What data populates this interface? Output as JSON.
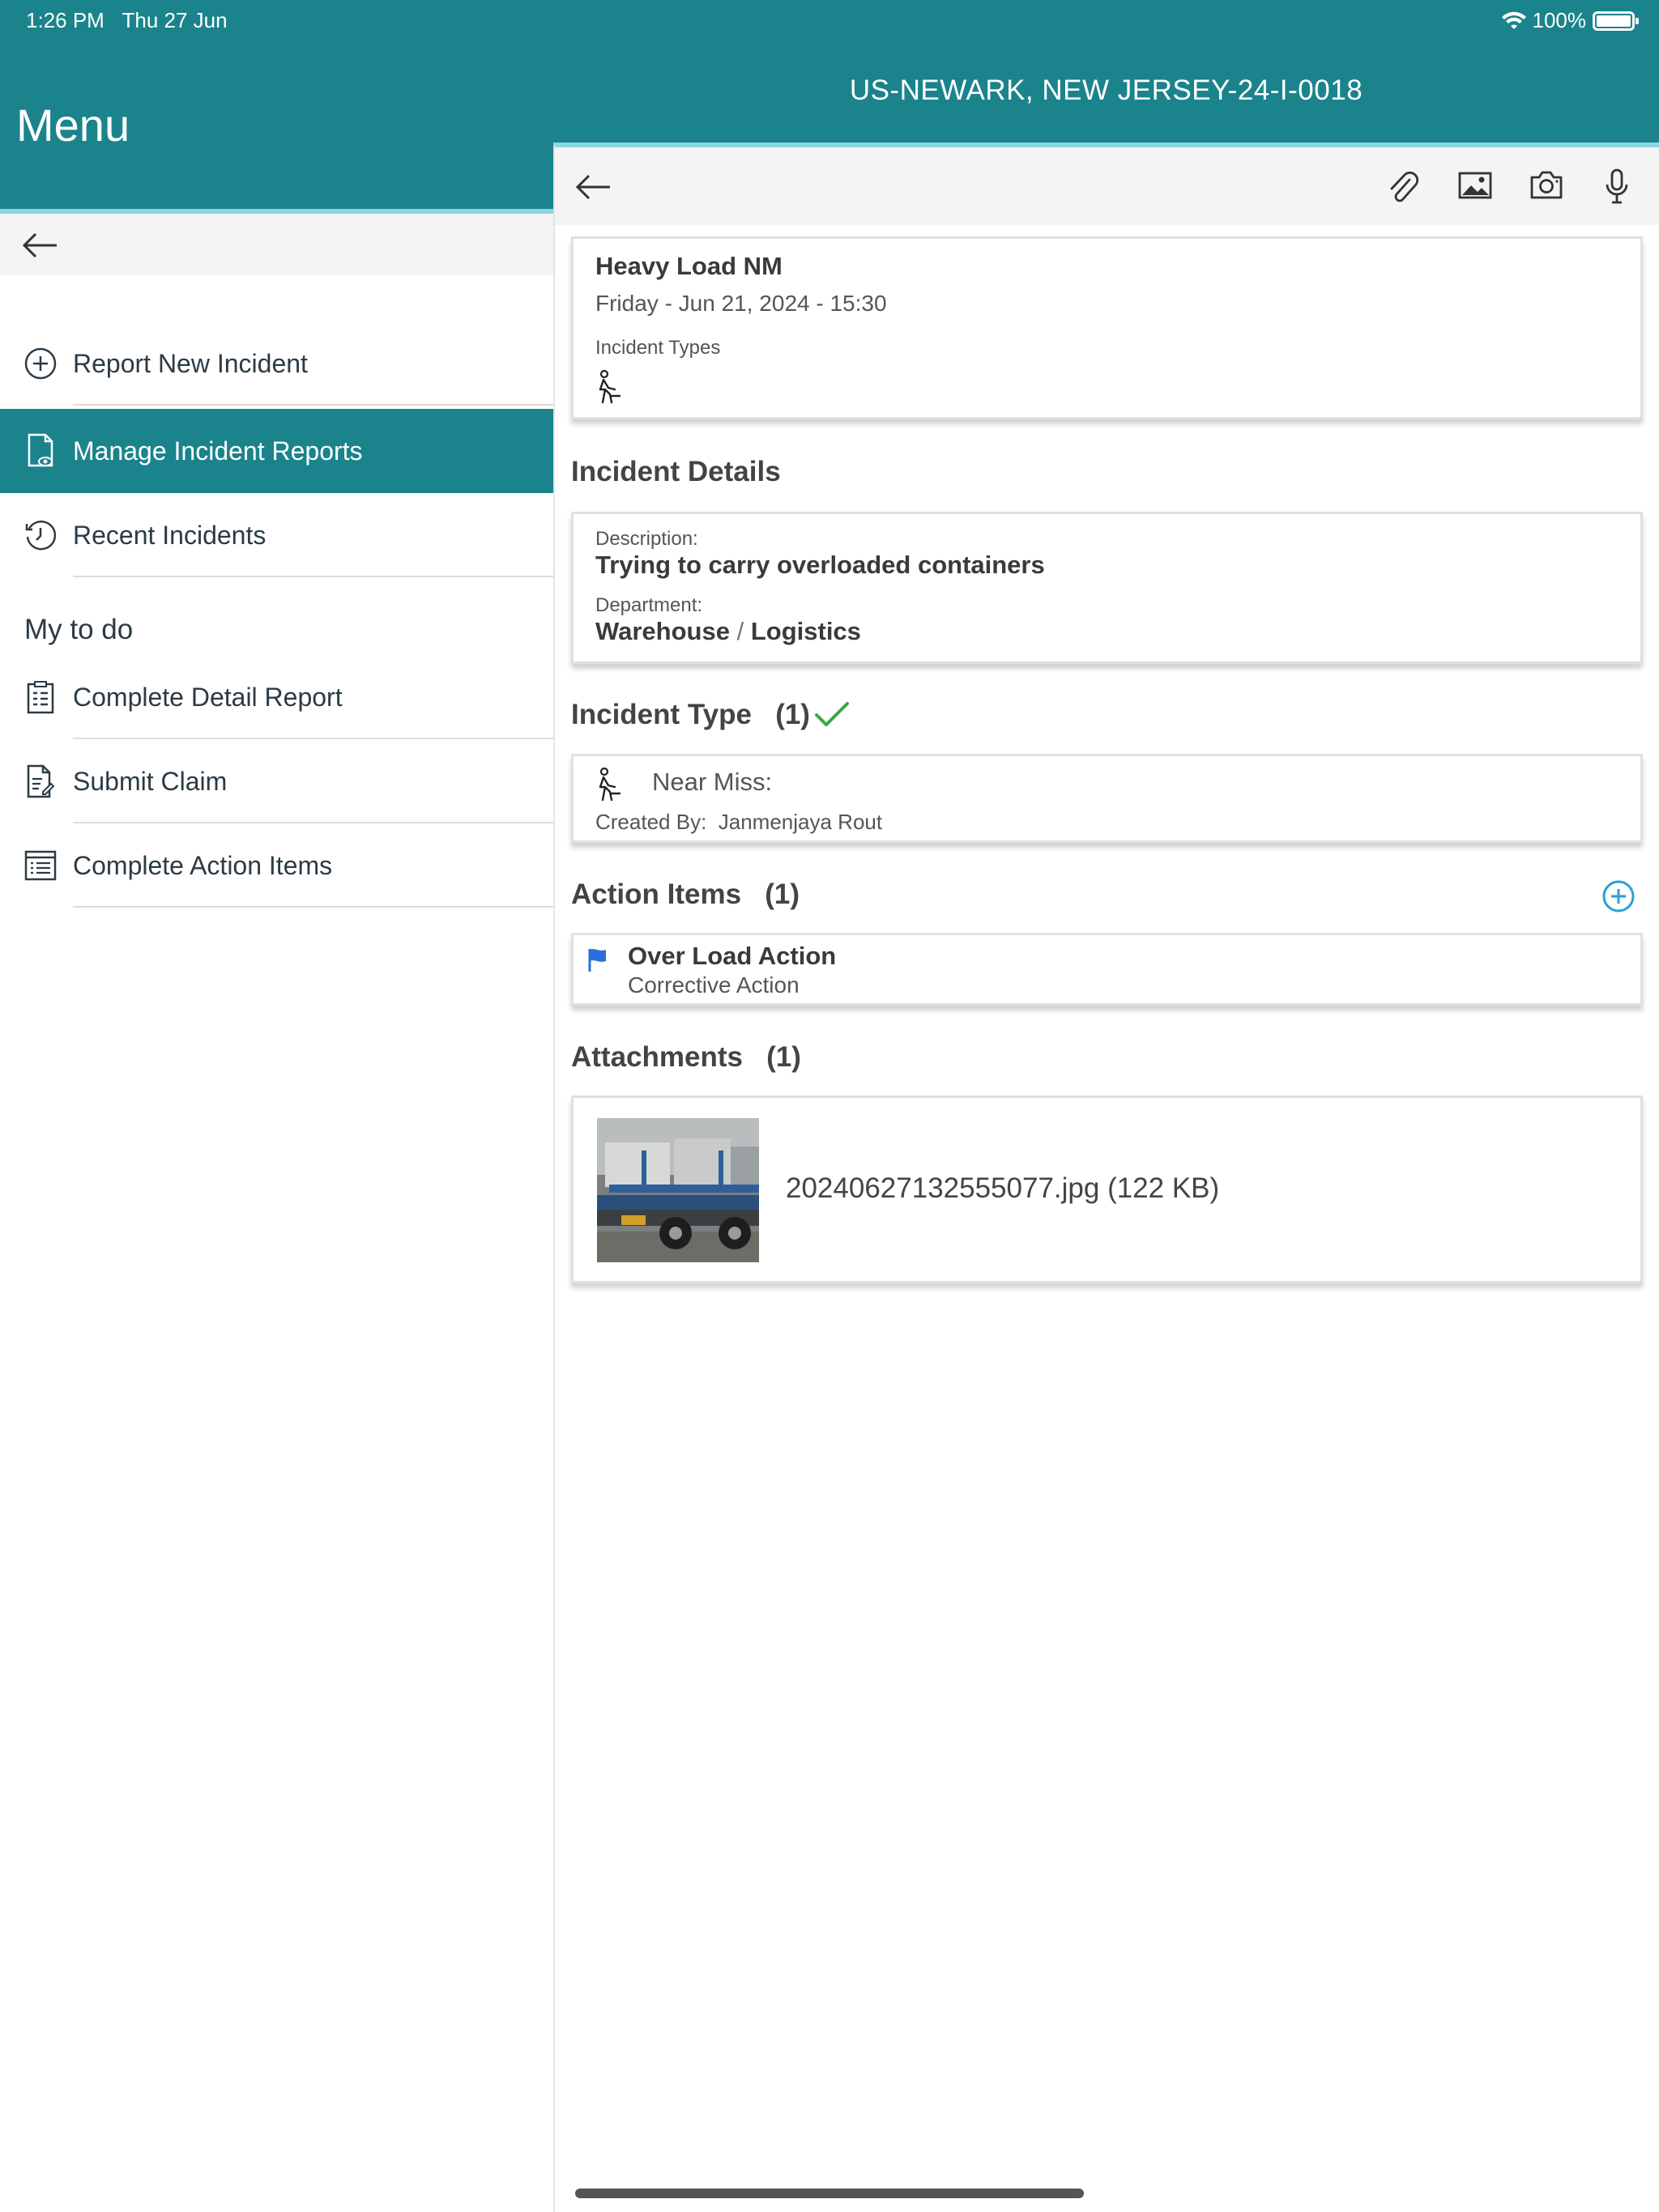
{
  "status_bar": {
    "time": "1:26 PM",
    "date": "Thu 27 Jun",
    "battery": "100%"
  },
  "sidebar": {
    "title": "Menu",
    "items": [
      {
        "label": "Report New Incident",
        "icon": "plus-circle-icon"
      },
      {
        "label": "Manage Incident Reports",
        "icon": "document-eye-icon",
        "active": true
      },
      {
        "label": "Recent Incidents",
        "icon": "history-icon"
      }
    ],
    "todo_label": "My to do",
    "todo_items": [
      {
        "label": "Complete Detail Report",
        "icon": "clipboard-list-icon"
      },
      {
        "label": "Submit Claim",
        "icon": "document-edit-icon"
      },
      {
        "label": "Complete Action Items",
        "icon": "list-icon"
      }
    ]
  },
  "header": {
    "title": "US-NEWARK, NEW JERSEY-24-I-0018"
  },
  "summary": {
    "title": "Heavy Load NM",
    "datetime": "Friday - Jun 21, 2024 - 15:30",
    "types_label": "Incident Types"
  },
  "incident_details": {
    "heading": "Incident Details",
    "description_label": "Description:",
    "description": "Trying to carry overloaded containers",
    "department_label": "Department:",
    "department_a": "Warehouse",
    "department_sep": "/",
    "department_b": "Logistics"
  },
  "incident_type": {
    "heading": "Incident Type",
    "count": "(1)",
    "name": "Near Miss:",
    "created_by_label": "Created By:",
    "created_by": "Janmenjaya Rout"
  },
  "action_items": {
    "heading": "Action Items",
    "count": "(1)",
    "item_title": "Over Load Action",
    "item_subtitle": "Corrective Action"
  },
  "attachments": {
    "heading": "Attachments",
    "count": "(1)",
    "file": "20240627132555077.jpg (122 KB)"
  },
  "colors": {
    "header": "#1b838b",
    "accent_line": "#8fd6e3",
    "check": "#3aa845",
    "flag": "#2a6fe0",
    "add": "#2a9fd6"
  }
}
